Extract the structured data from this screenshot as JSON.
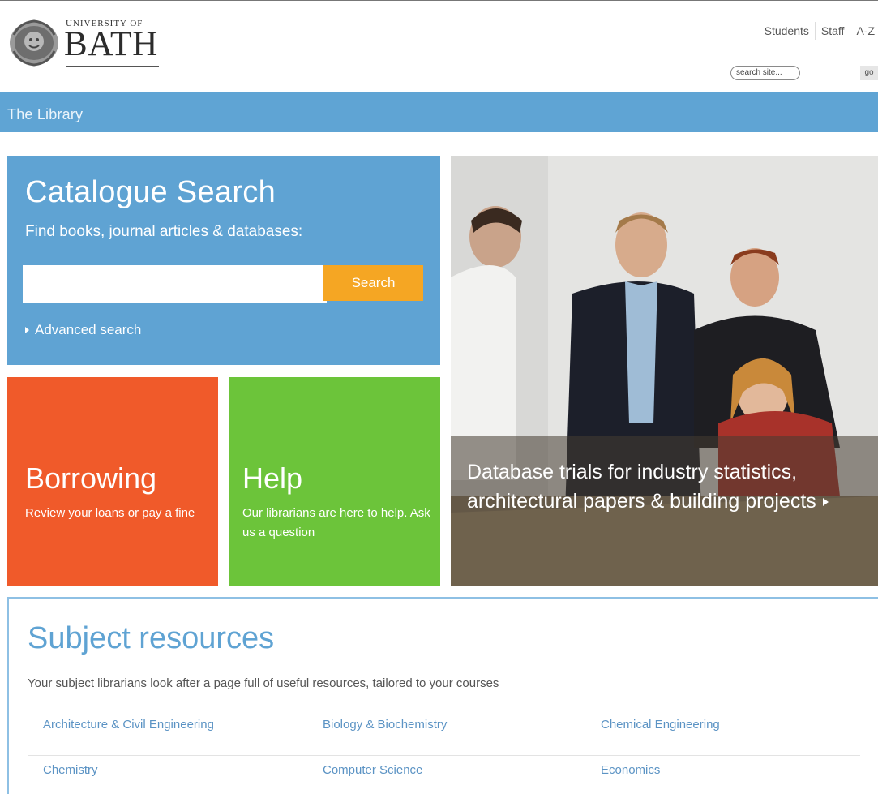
{
  "header": {
    "logo_top": "UNIVERSITY OF",
    "logo_main": "BATH",
    "top_links": [
      "Students",
      "Staff",
      "A-Z"
    ],
    "search_placeholder": "search site...",
    "go_label": "go"
  },
  "bar": {
    "title": "The Library"
  },
  "catalogue": {
    "title": "Catalogue Search",
    "subtitle": "Find books, journal articles & databases:",
    "search_button": "Search",
    "advanced": "Advanced search"
  },
  "borrowing": {
    "title": "Borrowing",
    "text": "Review your loans or pay a fine"
  },
  "help": {
    "title": "Help",
    "text": "Our librarians are here to help. Ask us a question"
  },
  "feature": {
    "caption": "Database trials for industry statistics, architectural papers & building projects"
  },
  "subjects": {
    "title": "Subject resources",
    "description": "Your subject librarians look after a page full of useful resources, tailored to your courses",
    "rows": [
      [
        "Architecture & Civil Engineering",
        "Biology & Biochemistry",
        "Chemical Engineering"
      ],
      [
        "Chemistry",
        "Computer Science",
        "Economics"
      ]
    ]
  },
  "colors": {
    "bar_blue": "#5fa4d4",
    "catalogue_blue": "#5fa3d3",
    "search_orange": "#f5a623",
    "borrowing_orange": "#f05a2a",
    "help_green": "#6cc43a",
    "link_blue": "#5b93c4"
  }
}
